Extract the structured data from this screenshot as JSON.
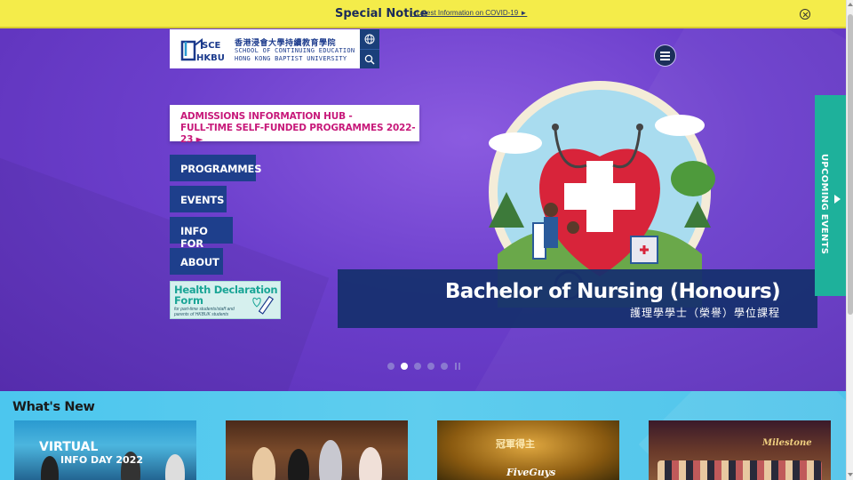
{
  "notice": {
    "title": "Special Notice",
    "link": "- Latest Information on COVID-19 ►"
  },
  "logo": {
    "abbr": "SCE",
    "hkbu": "HKBU",
    "name_zh": "香港浸會大學持續教育學院",
    "name_en_line1": "SCHOOL OF CONTINUING EDUCATION",
    "name_en_line2": "HONG KONG BAPTIST UNIVERSITY"
  },
  "admissions": {
    "line1": "ADMISSIONS INFORMATION HUB -",
    "line2": "FULL-TIME SELF-FUNDED PROGRAMMES 2022-23 ►"
  },
  "nav": [
    {
      "label": "PROGRAMMES"
    },
    {
      "label": "EVENTS"
    },
    {
      "label": "INFO FOR"
    },
    {
      "label": "ABOUT"
    }
  ],
  "health": {
    "line1": "Health Declaration",
    "line2": "Form",
    "sub1": "for part-time students/staff and",
    "sub2": "parents of HKBUK students"
  },
  "banner": {
    "title_en": "Bachelor of Nursing (Honours)",
    "title_zh": "護理學學士（榮譽）學位課程"
  },
  "upcoming": {
    "label": "UPCOMING EVENTS"
  },
  "carousel": {
    "slides": 5,
    "active": 2
  },
  "whats_new": {
    "title": "What's New",
    "card1_text1": "VIRTUAL",
    "card1_text2": "INFO DAY 2022",
    "card3_text1": "冠軍得主",
    "card3_text2": "FiveGuys",
    "card4_text1": "Milestone"
  },
  "colors": {
    "notice_bg": "#f4ec4a",
    "hero_bg": "#6c3fcc",
    "nav_bg": "#1e3f8c",
    "admissions_text": "#c7197a",
    "upcoming_bg": "#1eb19b",
    "whats_new_bg": "#4cc6ee"
  }
}
